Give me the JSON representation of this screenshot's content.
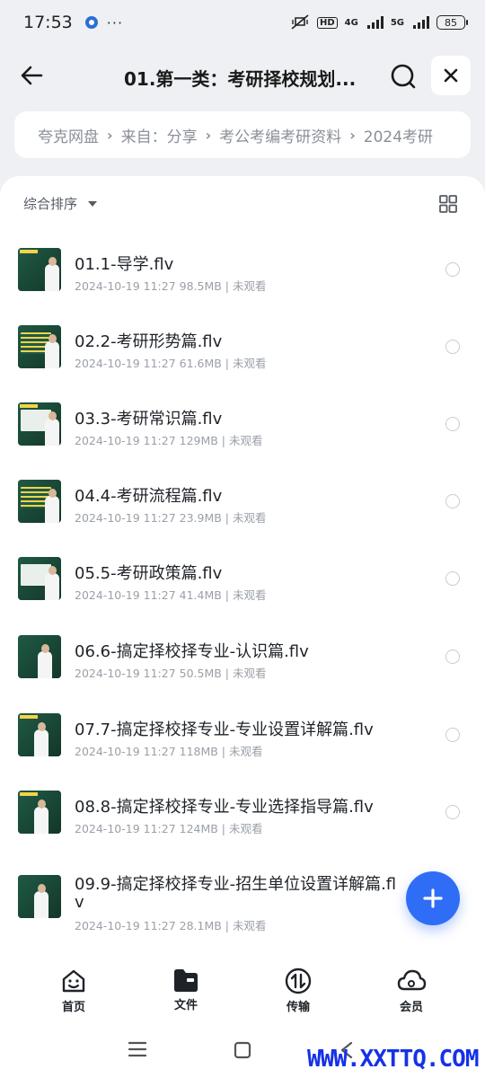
{
  "status_bar": {
    "time": "17:53",
    "more": "···",
    "hd": "HD",
    "net1": "4G",
    "net2": "5G",
    "battery": "85"
  },
  "header": {
    "title": "01.第一类：考研择校规划..."
  },
  "breadcrumb": {
    "items": [
      "夸克网盘",
      "来自：分享",
      "考公考编考研资料",
      "2024考研"
    ]
  },
  "toolbar": {
    "sort_label": "综合排序"
  },
  "files": [
    {
      "name": "01.1-导学.flv",
      "meta": "2024-10-19 11:27  98.5MB | 未观看"
    },
    {
      "name": "02.2-考研形势篇.flv",
      "meta": "2024-10-19 11:27  61.6MB | 未观看"
    },
    {
      "name": "03.3-考研常识篇.flv",
      "meta": "2024-10-19 11:27  129MB | 未观看"
    },
    {
      "name": "04.4-考研流程篇.flv",
      "meta": "2024-10-19 11:27  23.9MB | 未观看"
    },
    {
      "name": "05.5-考研政策篇.flv",
      "meta": "2024-10-19 11:27  41.4MB | 未观看"
    },
    {
      "name": "06.6-搞定择校择专业-认识篇.flv",
      "meta": "2024-10-19 11:27  50.5MB | 未观看"
    },
    {
      "name": "07.7-搞定择校择专业-专业设置详解篇.flv",
      "meta": "2024-10-19 11:27  118MB | 未观看"
    },
    {
      "name": "08.8-搞定择校择专业-专业选择指导篇.flv",
      "meta": "2024-10-19 11:27  124MB | 未观看"
    },
    {
      "name": "09.9-搞定择校择专业-招生单位设置详解篇.fl",
      "name2": "v",
      "meta": "2024-10-19 11:27  28.1MB | 未观看"
    }
  ],
  "bottom_nav": {
    "items": [
      {
        "label": "首页"
      },
      {
        "label": "文件"
      },
      {
        "label": "传输"
      },
      {
        "label": "会员"
      }
    ]
  },
  "watermark": "WWW.XXTTQ.COM",
  "colors": {
    "accent": "#2f6df6",
    "background": "#eef0f3"
  }
}
